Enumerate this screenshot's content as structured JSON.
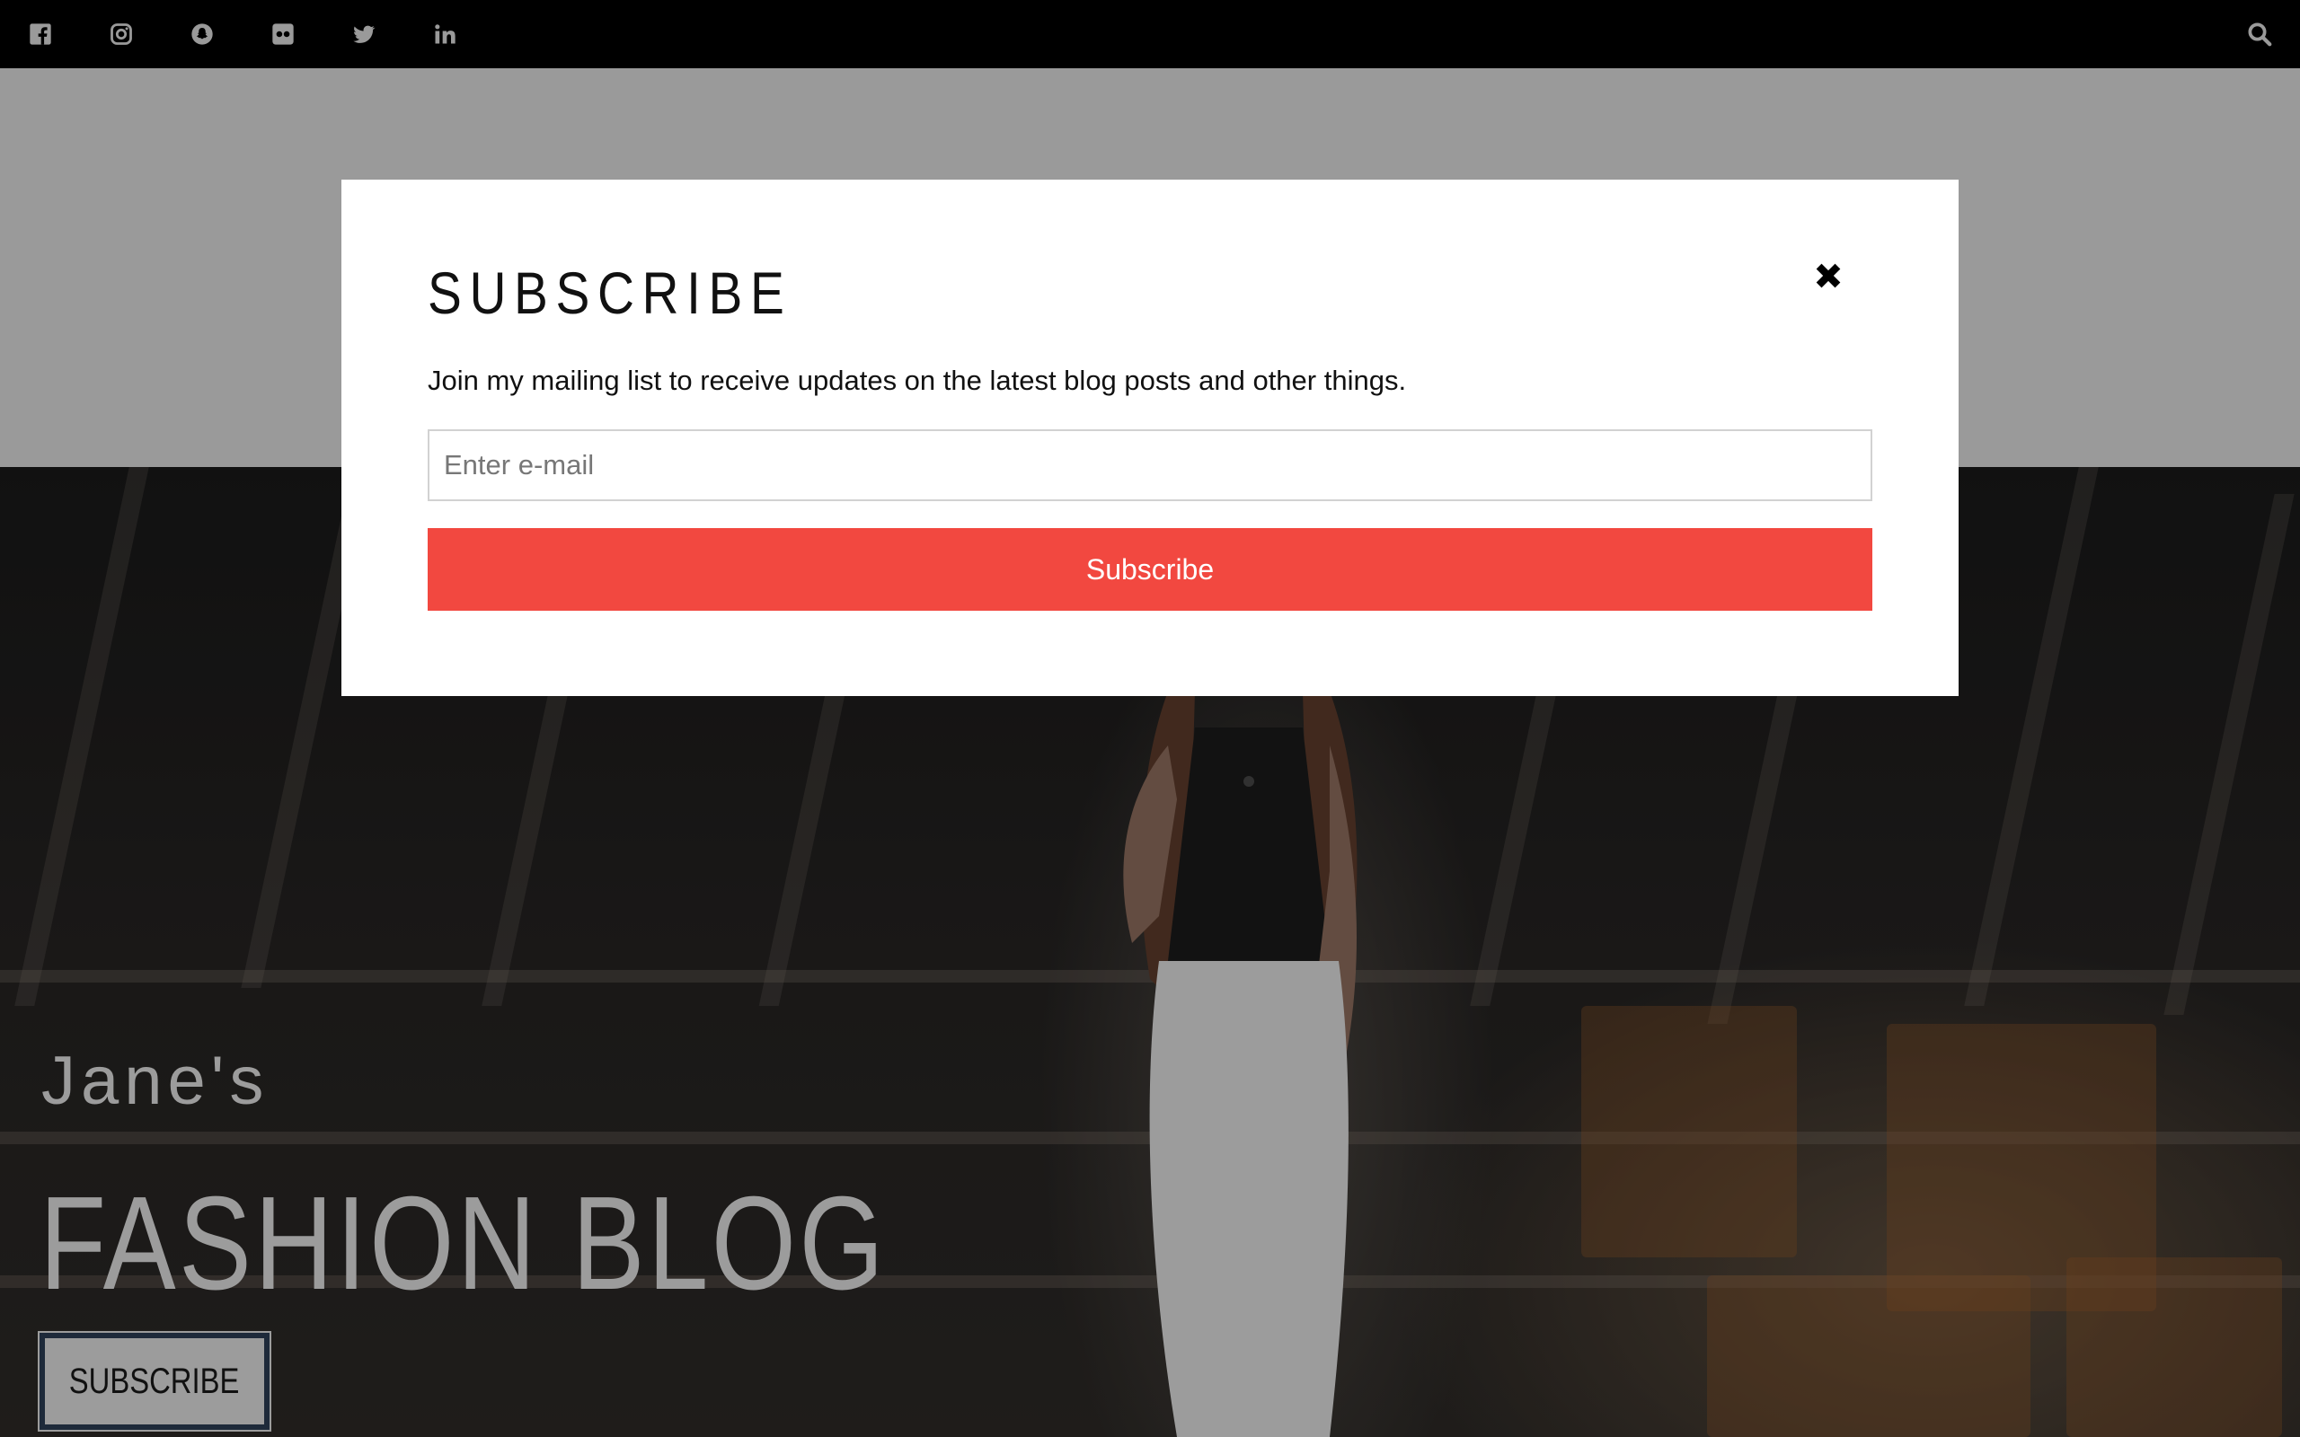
{
  "topbar": {
    "social": [
      "facebook-icon",
      "instagram-icon",
      "snapchat-icon",
      "flickr-icon",
      "twitter-icon",
      "linkedin-icon"
    ],
    "search_icon": "search-icon"
  },
  "hero": {
    "tagline": "Jane's",
    "title": "FASHION BLOG",
    "button_label": "SUBSCRIBE"
  },
  "modal": {
    "title": "SUBSCRIBE",
    "description": "Join my mailing list to receive updates on the latest blog posts and other things.",
    "email_placeholder": "Enter e-mail",
    "button_label": "Subscribe",
    "close_icon": "close-icon"
  },
  "colors": {
    "topbar": "#000000",
    "overlay": "#9a9a9a",
    "accent": "#f24840",
    "icon": "#9a9a9a"
  }
}
